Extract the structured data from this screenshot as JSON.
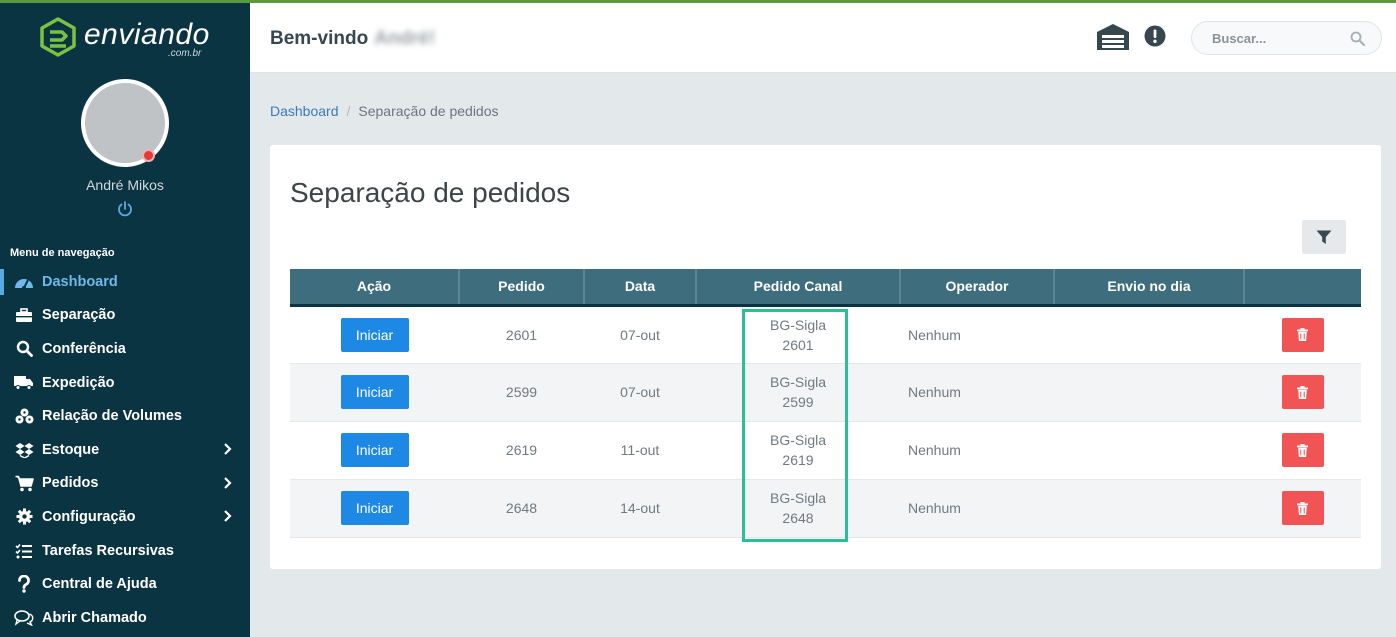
{
  "brand": {
    "name": "enviando",
    "sub": ".com.br",
    "accent": "#5a9a3a"
  },
  "user": {
    "name": "André Mikos",
    "welcome": "Bem-vindo",
    "welcome_name": "André!"
  },
  "sidebar": {
    "heading": "Menu de navegação",
    "items": [
      {
        "label": "Dashboard",
        "icon": "dashboard-icon"
      },
      {
        "label": "Separação",
        "icon": "briefcase-icon"
      },
      {
        "label": "Conferência",
        "icon": "search-icon"
      },
      {
        "label": "Expedição",
        "icon": "truck-icon"
      },
      {
        "label": "Relação de Volumes",
        "icon": "boxes-icon"
      },
      {
        "label": "Estoque",
        "icon": "dropbox-icon"
      },
      {
        "label": "Pedidos",
        "icon": "cart-icon"
      },
      {
        "label": "Configuração",
        "icon": "gear-icon"
      },
      {
        "label": "Tarefas Recursivas",
        "icon": "tasks-icon"
      },
      {
        "label": "Central de Ajuda",
        "icon": "question-icon"
      },
      {
        "label": "Abrir Chamado",
        "icon": "comments-icon"
      }
    ]
  },
  "search": {
    "placeholder": "Buscar..."
  },
  "breadcrumb": {
    "home": "Dashboard",
    "current": "Separação de pedidos"
  },
  "page": {
    "title": "Separação de pedidos"
  },
  "table": {
    "headers": [
      "Ação",
      "Pedido",
      "Data",
      "Pedido Canal",
      "Operador",
      "Envio no dia",
      ""
    ],
    "action_label": "Iniciar",
    "rows": [
      {
        "pedido": "2601",
        "data": "07-out",
        "canal_1": "BG-Sigla",
        "canal_2": "2601",
        "operador": "Nenhum",
        "envio": ""
      },
      {
        "pedido": "2599",
        "data": "07-out",
        "canal_1": "BG-Sigla",
        "canal_2": "2599",
        "operador": "Nenhum",
        "envio": ""
      },
      {
        "pedido": "2619",
        "data": "11-out",
        "canal_1": "BG-Sigla",
        "canal_2": "2619",
        "operador": "Nenhum",
        "envio": ""
      },
      {
        "pedido": "2648",
        "data": "14-out",
        "canal_1": "BG-Sigla",
        "canal_2": "2648",
        "operador": "Nenhum",
        "envio": ""
      }
    ]
  },
  "colors": {
    "sidebar": "#0b3442",
    "table_header": "#3e6e7e",
    "primary": "#1e88e5",
    "danger": "#f05454",
    "highlight": "#2abf96"
  }
}
